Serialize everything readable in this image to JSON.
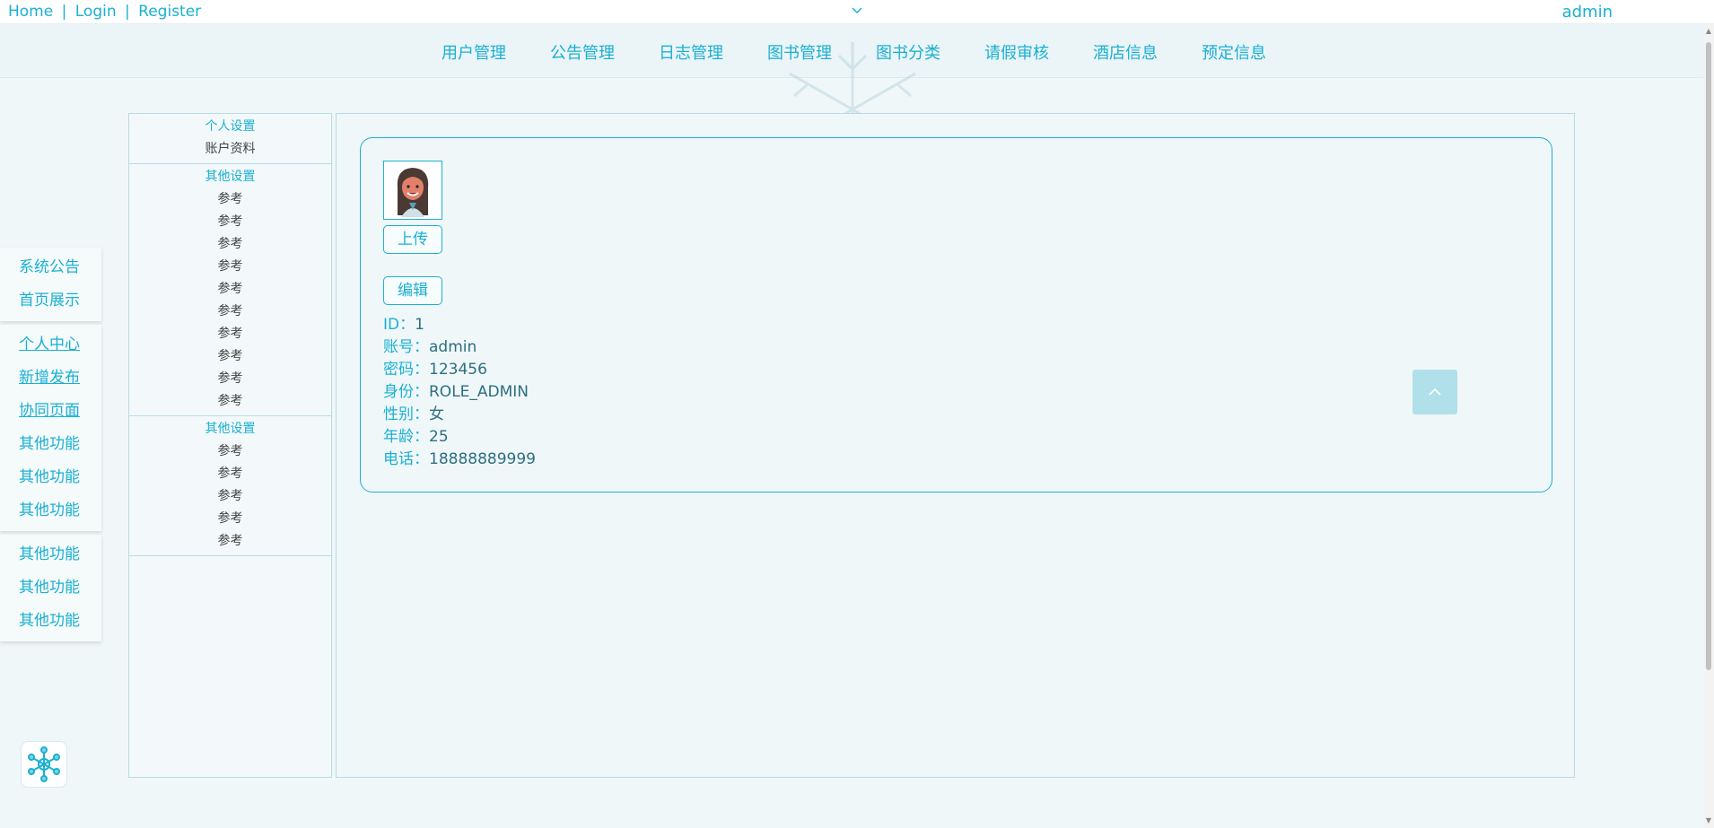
{
  "topbar": {
    "home": "Home",
    "login": "Login",
    "register": "Register",
    "sep": "|",
    "user": "admin"
  },
  "mainnav": {
    "items": [
      "用户管理",
      "公告管理",
      "日志管理",
      "图书管理",
      "图书分类",
      "请假审核",
      "酒店信息",
      "预定信息"
    ]
  },
  "floatmenu": {
    "group1": [
      "系统公告",
      "首页展示"
    ],
    "group2": [
      "个人中心",
      "新增发布",
      "协同页面",
      "其他功能",
      "其他功能",
      "其他功能"
    ],
    "group3": [
      "其他功能",
      "其他功能",
      "其他功能"
    ]
  },
  "sidepanel": {
    "sec1_head": "个人设置",
    "sec1_item": "账户资料",
    "sec2_head": "其他设置",
    "sec2_items": [
      "参考",
      "参考",
      "参考",
      "参考",
      "参考",
      "参考",
      "参考",
      "参考",
      "参考",
      "参考"
    ],
    "sec3_head": "其他设置",
    "sec3_items": [
      "参考",
      "参考",
      "参考",
      "参考",
      "参考"
    ]
  },
  "profile": {
    "upload_label": "上传",
    "edit_label": "编辑",
    "fields": [
      {
        "k": "ID：",
        "v": "1"
      },
      {
        "k": "账号：",
        "v": "admin"
      },
      {
        "k": "密码：",
        "v": "123456"
      },
      {
        "k": "身份：",
        "v": "ROLE_ADMIN"
      },
      {
        "k": "性别：",
        "v": "女"
      },
      {
        "k": "年龄：",
        "v": "25"
      },
      {
        "k": "电话：",
        "v": "18888889999"
      }
    ]
  },
  "icons": {
    "chevron": "chevron-down-icon",
    "totop": "chevron-up-icon",
    "logo": "snowflake-logo-icon"
  },
  "colors": {
    "accent": "#1ab0d2",
    "background": "#f0f7f9"
  }
}
